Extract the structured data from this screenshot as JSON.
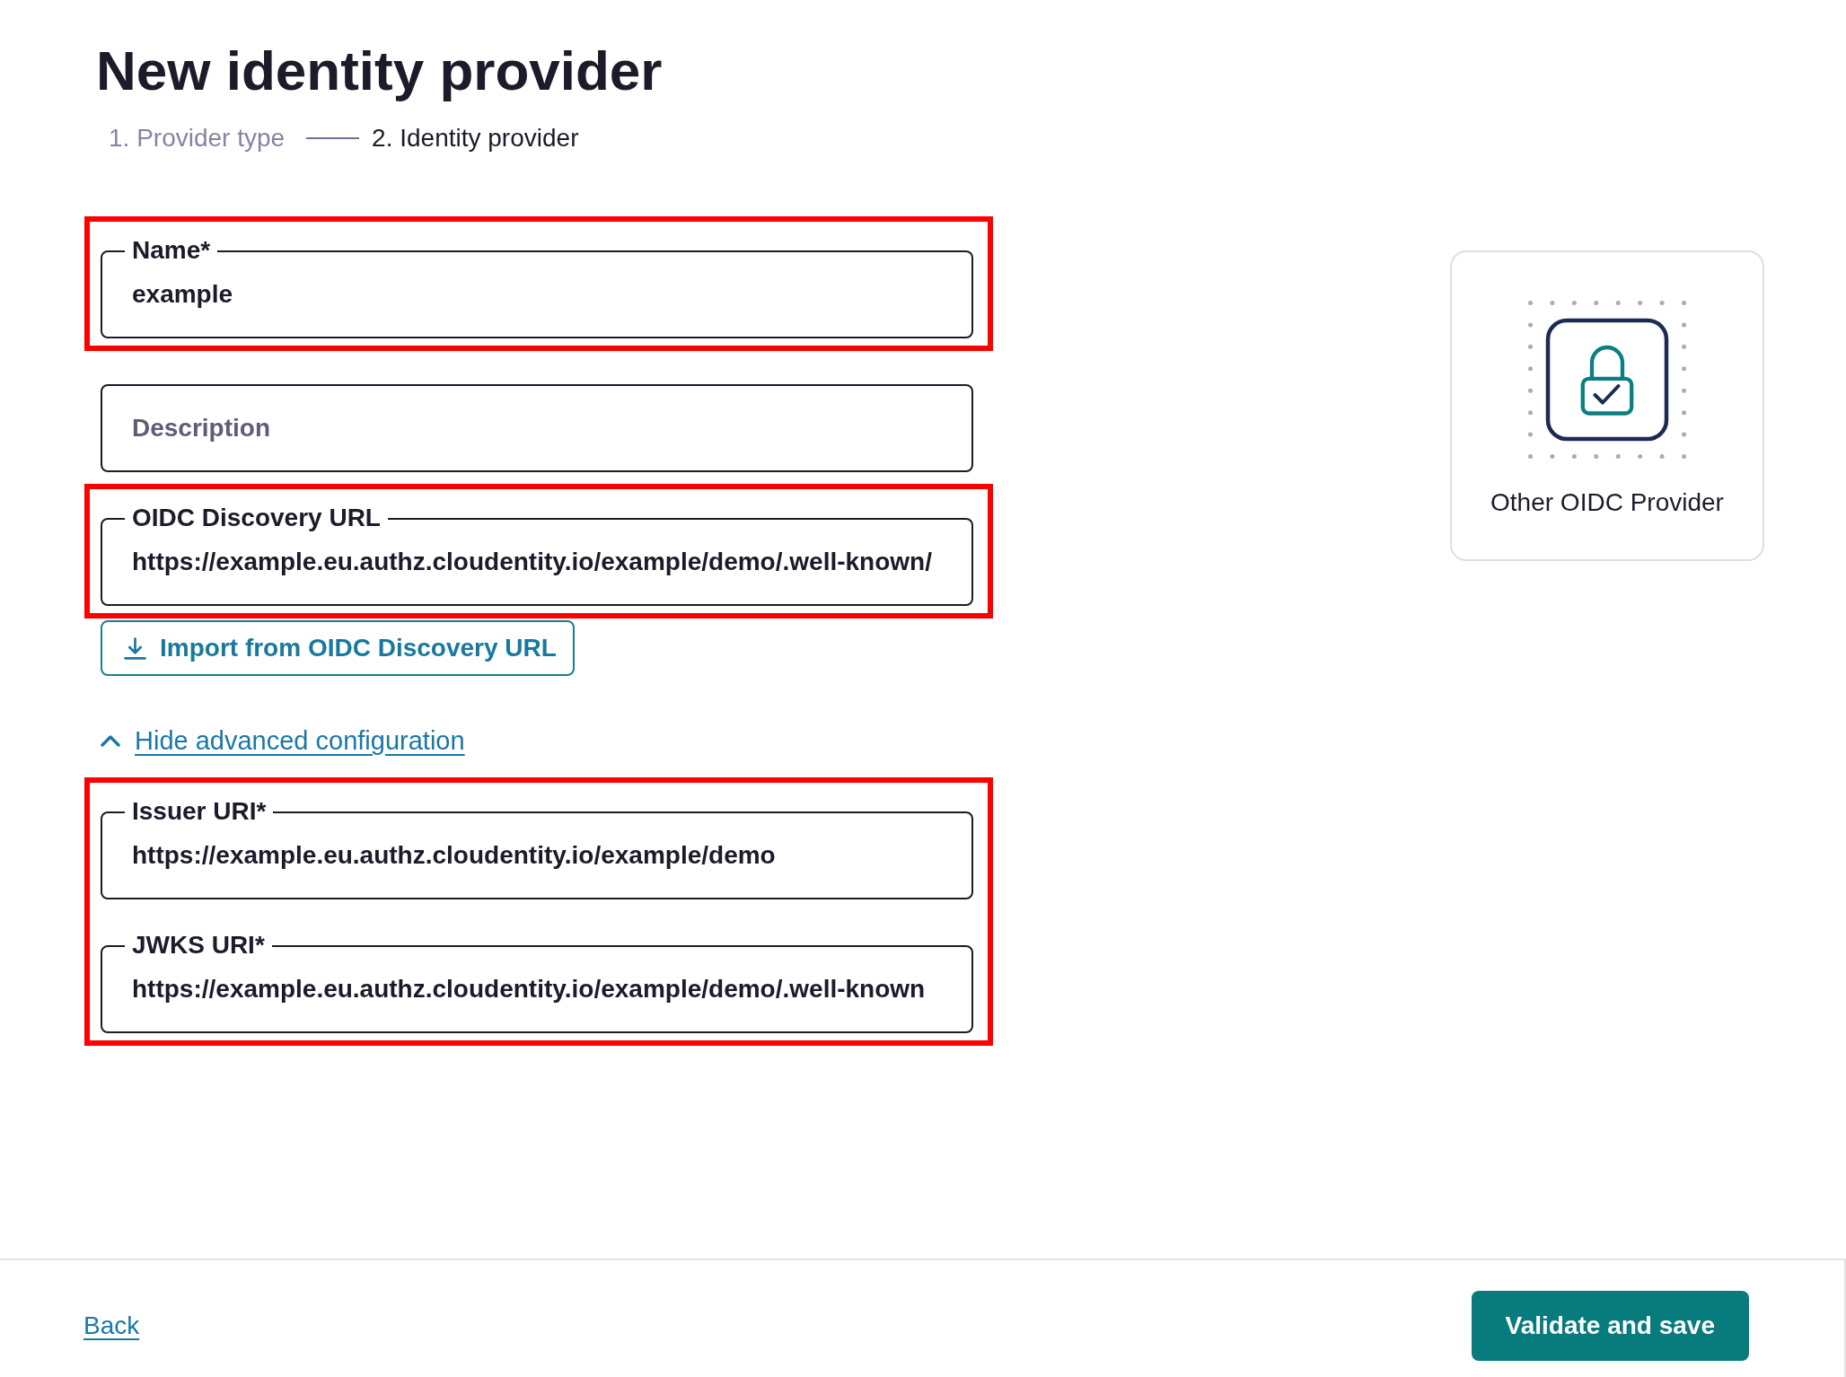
{
  "page": {
    "title": "New identity provider"
  },
  "stepper": {
    "steps": [
      {
        "label": "1. Provider type",
        "selected": false
      },
      {
        "label": "2. Identity provider",
        "selected": true
      }
    ]
  },
  "form": {
    "groups": [
      {
        "highlighted": true,
        "fields": [
          {
            "label": "Name*",
            "value": "example"
          }
        ]
      },
      {
        "highlighted": false,
        "fields": [
          {
            "placeholder": "Description"
          }
        ]
      },
      {
        "highlighted": true,
        "fields": [
          {
            "label": "OIDC Discovery URL",
            "value": "https://example.eu.authz.cloudentity.io/example/demo/.well-known/"
          }
        ]
      }
    ],
    "import_button": {
      "label": "Import from OIDC Discovery URL"
    },
    "advanced_toggle": {
      "label": "Hide advanced configuration",
      "expanded": true
    },
    "advanced_groups": [
      {
        "highlighted": true,
        "fields": [
          {
            "label": "Issuer URI*",
            "value": "https://example.eu.authz.cloudentity.io/example/demo"
          },
          {
            "label": "JWKS URI*",
            "value": "https://example.eu.authz.cloudentity.io/example/demo/.well-known"
          }
        ]
      }
    ]
  },
  "provider_card": {
    "label": "Other OIDC Provider"
  },
  "footer": {
    "back_link": {
      "label": "Back"
    },
    "submit_button": {
      "label": "Validate and save"
    }
  }
}
